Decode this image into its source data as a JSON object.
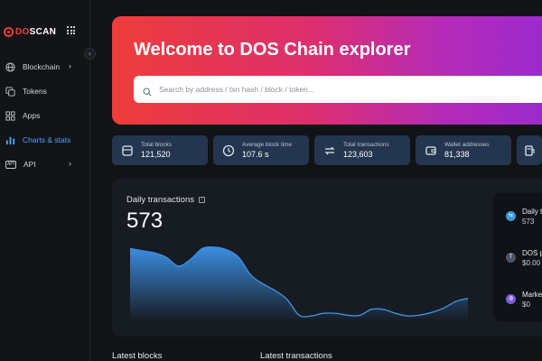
{
  "brand": {
    "logo_prefix": "DO",
    "logo_suffix": "SCAN"
  },
  "sidebar": {
    "collapse_glyph": "‹",
    "items": [
      {
        "label": "Blockchain",
        "icon": "globe-icon",
        "has_chevron": true
      },
      {
        "label": "Tokens",
        "icon": "tokens-icon",
        "has_chevron": false
      },
      {
        "label": "Apps",
        "icon": "apps-grid-icon",
        "has_chevron": false
      },
      {
        "label": "Charts & stats",
        "icon": "bar-chart-icon",
        "has_chevron": false,
        "active": true
      },
      {
        "label": "API",
        "icon": "api-icon",
        "has_chevron": true
      }
    ],
    "chevron_glyph": "›",
    "api_badge": "API"
  },
  "hero": {
    "title": "Welcome to DOS Chain explorer",
    "search_placeholder": "Search by address / txn hash / block / token..."
  },
  "stats": [
    {
      "label": "Total blocks",
      "value": "121,520",
      "icon": "clock-icon"
    },
    {
      "label": "Average block time",
      "value": "107.6 s",
      "icon": "clock-icon"
    },
    {
      "label": "Total transactions",
      "value": "123,603",
      "icon": "transfer-icon"
    },
    {
      "label": "Wallet addresses",
      "value": "81,338",
      "icon": "wallet-icon"
    },
    {
      "label": "",
      "value": "",
      "icon": "gas-pump-icon"
    }
  ],
  "chart": {
    "title": "Daily transactions",
    "info_glyph": "i",
    "current_value": "573"
  },
  "chart_data": {
    "type": "area",
    "x": [
      0,
      1,
      2,
      3,
      4,
      5,
      6,
      7,
      8,
      9,
      10,
      11,
      12,
      13,
      14,
      15,
      16,
      17,
      18,
      19,
      20,
      21,
      22,
      23,
      24,
      25,
      26,
      27,
      28
    ],
    "values": [
      1650,
      1600,
      1550,
      1450,
      1250,
      1400,
      1650,
      1680,
      1620,
      1450,
      1050,
      850,
      700,
      500,
      140,
      120,
      180,
      180,
      140,
      130,
      270,
      270,
      180,
      120,
      140,
      200,
      300,
      450,
      520
    ],
    "ylim": [
      0,
      1800
    ],
    "grid": false,
    "colors": {
      "line": "#3d8fe0",
      "fill_top": "#3b8ee0",
      "fill_bottom": "#171b22"
    }
  },
  "side_summary": [
    {
      "label": "Daily t",
      "value": "573",
      "icon": "transfer-icon",
      "color": "#3a9ad9",
      "glyph": "⇆"
    },
    {
      "label": "DOS p",
      "value": "$0.00",
      "icon": "token-icon",
      "color": "#4a5563",
      "glyph": "T"
    },
    {
      "label": "Marke",
      "value": "$0",
      "icon": "globe-icon",
      "color": "#7b5be0",
      "glyph": "◍"
    }
  ],
  "sections": {
    "latest_blocks": "Latest blocks",
    "latest_transactions": "Latest transactions"
  }
}
